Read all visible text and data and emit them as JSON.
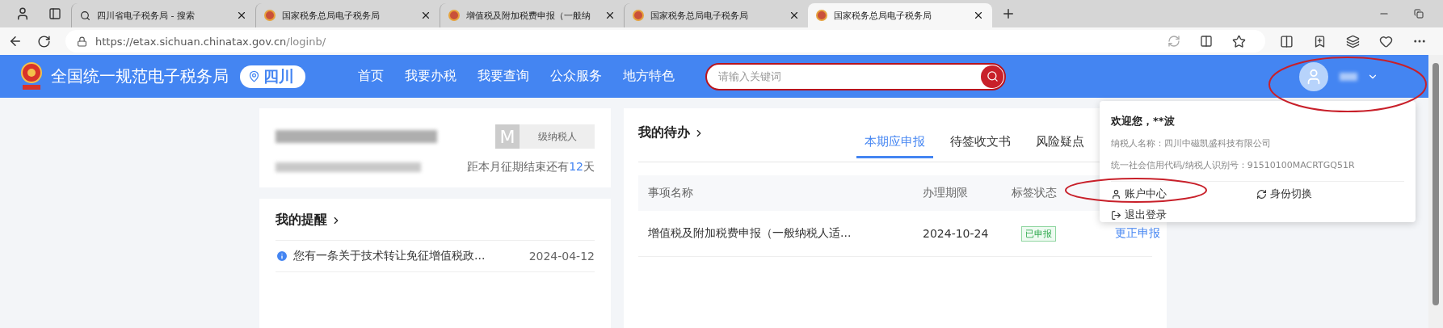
{
  "browser": {
    "tabs": [
      {
        "title": "四川省电子税务局 - 搜索",
        "selected": false
      },
      {
        "title": "国家税务总局电子税务局",
        "selected": false
      },
      {
        "title": "增值税及附加税费申报（一般纳",
        "selected": false
      },
      {
        "title": "国家税务总局电子税务局",
        "selected": false
      },
      {
        "title": "国家税务总局电子税务局",
        "selected": true
      }
    ],
    "url": {
      "host": "https://etax.sichuan.chinatax.gov.cn",
      "path": "/loginb/"
    }
  },
  "header": {
    "title": "全国统一规范电子税务局",
    "region": "四川",
    "nav": [
      "首页",
      "我要办税",
      "我要查询",
      "公众服务",
      "地方特色"
    ],
    "search": {
      "placeholder": "请输入关键词"
    }
  },
  "taxpayer_card": {
    "grade_badge": "M",
    "grade_label": "级纳税人",
    "deadline": {
      "prefix": "距本月征期结束还有",
      "days": "12",
      "suffix": "天"
    }
  },
  "reminders": {
    "title": "我的提醒",
    "items": [
      {
        "text": "您有一条关于技术转让免征增值税政...",
        "date": "2024-04-12"
      }
    ]
  },
  "todo": {
    "title": "我的待办",
    "tabs": [
      {
        "label": "本期应申报",
        "selected": true
      },
      {
        "label": "待签收文书",
        "selected": false
      },
      {
        "label": "风险疑点",
        "selected": false
      }
    ],
    "columns": [
      "事项名称",
      "办理期限",
      "标签状态"
    ],
    "rows": [
      {
        "name": "增值税及附加税费申报（一般纳税人适...",
        "deadline": "2024-10-24",
        "status": "已申报",
        "action": "更正申报"
      }
    ]
  },
  "user_menu": {
    "greeting": "欢迎您，**波",
    "taxpayer_name": "纳税人名称：四川中磁凯盛科技有限公司",
    "credit_code": "统一社会信用代码/纳税人识别号：91510100MACRTGQ51R",
    "actions": [
      {
        "kind": "account",
        "label": "账户中心"
      },
      {
        "kind": "switch",
        "label": "身份切换"
      },
      {
        "kind": "logout",
        "label": "退出登录"
      }
    ]
  },
  "annotations": [
    {
      "kind": "ellipse"
    },
    {
      "kind": "ellipse"
    }
  ]
}
